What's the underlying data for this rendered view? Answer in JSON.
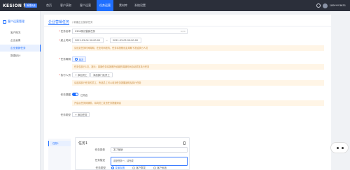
{
  "app": {
    "logo": "KESION 科汛",
    "logo_tag": "管理系统"
  },
  "top_nav": {
    "items": [
      "首页",
      "客户获取",
      "客户运营",
      "任务运营",
      "素材库",
      "系统设置"
    ],
    "active_index": 2,
    "user_name": "189****3631"
  },
  "sidebar": {
    "group_label": "客户运营管理",
    "items": [
      "客户概况",
      "企业画像",
      "企业营销任务",
      "数据统计"
    ],
    "active_index": 2
  },
  "page": {
    "title": "企业营销任务",
    "breadcrumb": "/ 新建企业营销任务"
  },
  "form": {
    "task_name": {
      "label": "任务名称",
      "value": "0306测试营销任务",
      "counter": "9/20"
    },
    "time": {
      "label": "起止时间",
      "start": "2021-03-04 00:00:00",
      "end": "2021-03-05 00:00:00",
      "separator": "→"
    },
    "time_tip": "请设定任务时间周期，在此时间段内，任务将按照设定周期下发给执行人员",
    "task_cycle": {
      "label": "任务周期",
      "selected": "单次"
    },
    "cycle_tip": "任务仅执行1次，提示：周期任务将按照所设置的周期时间自动重复执行任务",
    "executor": {
      "label": "执行人员",
      "add_button": "+ 添加员工",
      "add_dept_button": "添加部门及员工"
    },
    "executor_tip": "请选择执行任务的员工，所选员工可以收到任务提醒通知及执行任务",
    "reminder": {
      "label": "任务提醒",
      "state_label": "已开启"
    },
    "reminder_tip": "开启后任务到期前，将向员工发送任务提醒消息",
    "task_type": {
      "label": "任务类型",
      "add_button": "+ 添加任务"
    }
  },
  "task": {
    "tab_label": "任务1",
    "title": "任务1",
    "type_label": "任务类型",
    "type_value": "发了营销",
    "desc_label": "任务描述",
    "desc_value": "这是任务一，请完成",
    "method_label": "任务类型",
    "methods": [
      "发朋友圈",
      "客户群发",
      "客户私信"
    ],
    "method_selected": 0
  }
}
